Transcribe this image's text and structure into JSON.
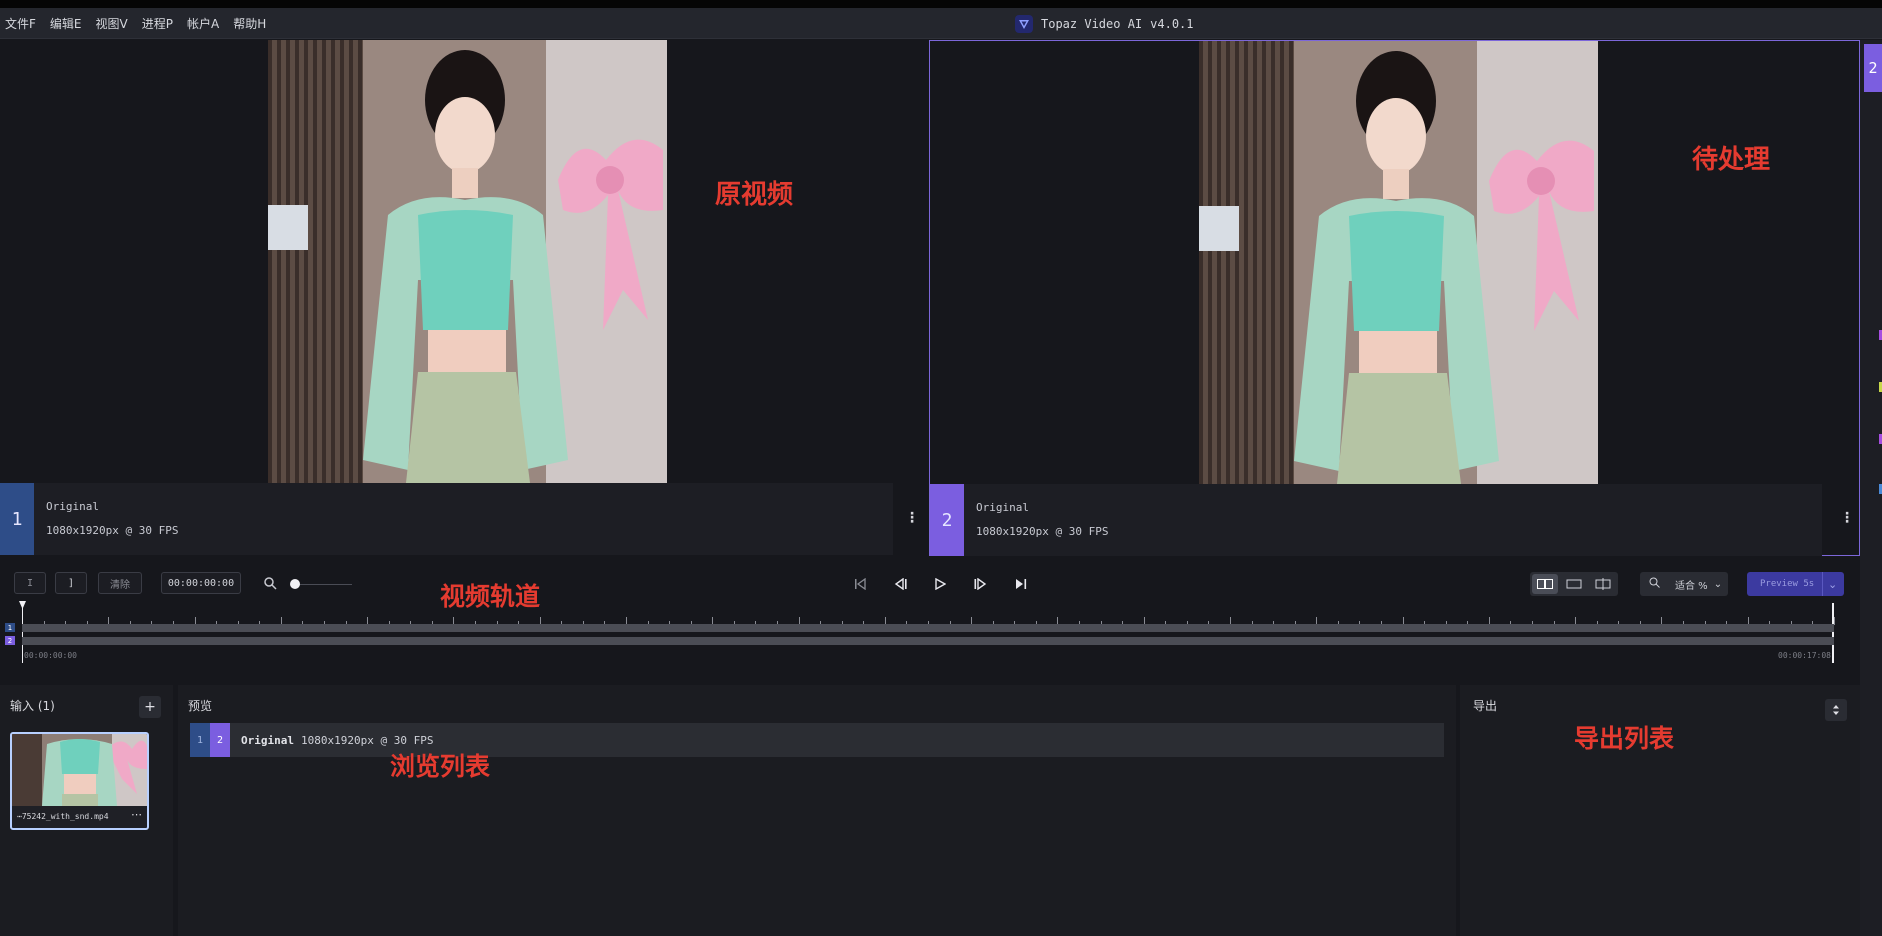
{
  "menu": [
    "文件F",
    "编辑E",
    "视图V",
    "进程P",
    "帐户A",
    "帮助H"
  ],
  "app": {
    "name": "Topaz Video AI",
    "version": "v4.0.1"
  },
  "viewer1": {
    "number": "1",
    "title": "Original",
    "spec": "1080x1920px @ 30 FPS",
    "annotation": "原视频"
  },
  "viewer2": {
    "number": "2",
    "title": "Original",
    "spec": "1080x1920px @ 30 FPS",
    "annotation": "待处理"
  },
  "right_tab": {
    "number": "2"
  },
  "transport": {
    "in_field": "I",
    "out_field": "]",
    "clear_label": "清除",
    "timecode": "00:00:00:00",
    "annotation": "视频轨道",
    "zoom_label": "适合 %",
    "preview_label": "Preview 5s"
  },
  "timeline": {
    "start": "00:00:00:00",
    "end": "00:00:17:08",
    "track1": "1",
    "track2": "2"
  },
  "input_panel": {
    "title": "输入 (1)",
    "add_label": "+",
    "file_name": "⋯75242_with_snd.mp4",
    "more": "⋯"
  },
  "preview_panel": {
    "title": "预览",
    "row_num1": "1",
    "row_num2": "2",
    "row_title": "Original",
    "row_spec": "1080x1920px @ 30 FPS",
    "annotation": "浏览列表"
  },
  "export_panel": {
    "title": "导出",
    "annotation": "导出列表"
  },
  "colors": {
    "accent": "#7b5ee0",
    "blue": "#2e4d88",
    "annotation_red": "#e53b30"
  }
}
